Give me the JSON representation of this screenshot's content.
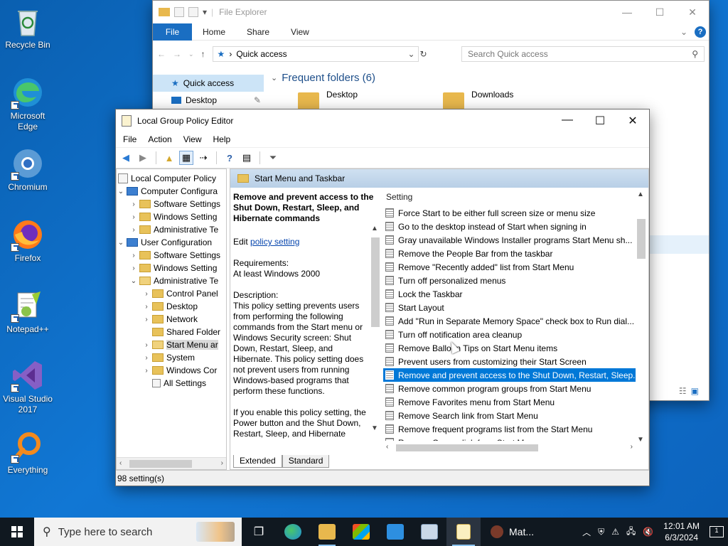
{
  "desktop": {
    "icons": [
      {
        "label": "Recycle Bin",
        "icon": "recycle-bin-icon"
      },
      {
        "label": "Microsoft Edge",
        "icon": "edge-icon"
      },
      {
        "label": "Chromium",
        "icon": "chromium-icon"
      },
      {
        "label": "Firefox",
        "icon": "firefox-icon"
      },
      {
        "label": "Notepad++",
        "icon": "notepadpp-icon"
      },
      {
        "label": "Visual Studio 2017",
        "icon": "visual-studio-icon"
      },
      {
        "label": "Everything",
        "icon": "everything-icon"
      }
    ]
  },
  "explorer": {
    "title": "File Explorer",
    "tabs": {
      "file": "File",
      "home": "Home",
      "share": "Share",
      "view": "View"
    },
    "address": "Quick access",
    "search_placeholder": "Search Quick access",
    "nav": {
      "quick_access": "Quick access",
      "desktop": "Desktop"
    },
    "frequent_header": "Frequent folders (6)",
    "folders": [
      "Desktop",
      "Downloads"
    ]
  },
  "gpe": {
    "title": "Local Group Policy Editor",
    "menu": {
      "file": "File",
      "action": "Action",
      "view": "View",
      "help": "Help"
    },
    "tree": {
      "root": "Local Computer Policy",
      "computer": "Computer Configura",
      "c_software": "Software Settings",
      "c_windows": "Windows Setting",
      "c_admin": "Administrative Te",
      "user": "User Configuration",
      "u_software": "Software Settings",
      "u_windows": "Windows Setting",
      "u_admin": "Administrative Te",
      "control_panel": "Control Panel",
      "desktop": "Desktop",
      "network": "Network",
      "shared_folders": "Shared Folder",
      "start_menu": "Start Menu ar",
      "system": "System",
      "windows_comp": "Windows Cor",
      "all_settings": "All Settings"
    },
    "pane_header": "Start Menu and Taskbar",
    "description": {
      "title": "Remove and prevent access to the Shut Down, Restart, Sleep, and Hibernate commands",
      "edit_prefix": "Edit ",
      "edit_link": "policy setting ",
      "requirements_label": "Requirements:",
      "requirements_value": "At least Windows 2000",
      "description_label": "Description:",
      "description_text": "This policy setting prevents users from performing the following commands from the Start menu or Windows Security screen: Shut Down, Restart, Sleep, and Hibernate. This policy setting does not prevent users from running Windows-based programs that perform these functions.",
      "enable_text": "If you enable this policy setting, the Power button and the Shut Down, Restart, Sleep, and Hibernate commands are removed from the Start menu. The"
    },
    "settings_header": "Setting",
    "settings": [
      "Force Start to be either full screen size or menu size",
      "Go to the desktop instead of Start when signing in",
      "Gray unavailable Windows Installer programs Start Menu sh...",
      "Remove the People Bar from the taskbar",
      "Remove \"Recently added\" list from Start Menu",
      "Turn off personalized menus",
      "Lock the Taskbar",
      "Start Layout",
      "Add \"Run in Separate Memory Space\" check box to Run dial...",
      "Turn off notification area cleanup",
      "Remove Balloon Tips on Start Menu items",
      "Prevent users from customizing their Start Screen",
      "Remove and prevent access to the Shut Down, Restart, Sleep...",
      "Remove common program groups from Start Menu",
      "Remove Favorites menu from Start Menu",
      "Remove Search link from Start Menu",
      "Remove frequent programs list from the Start Menu",
      "Remove Games link from Start Menu"
    ],
    "tabs": {
      "extended": "Extended",
      "standard": "Standard"
    },
    "status": "98 setting(s)"
  },
  "taskbar": {
    "search_placeholder": "Type here to search",
    "mat_label": "Mat...",
    "time": "12:01 AM",
    "date": "6/3/2024",
    "notifications": "1"
  },
  "colors": {
    "selection": "#0078d7",
    "desktop": "#1177d4",
    "taskbar": "#101820"
  }
}
